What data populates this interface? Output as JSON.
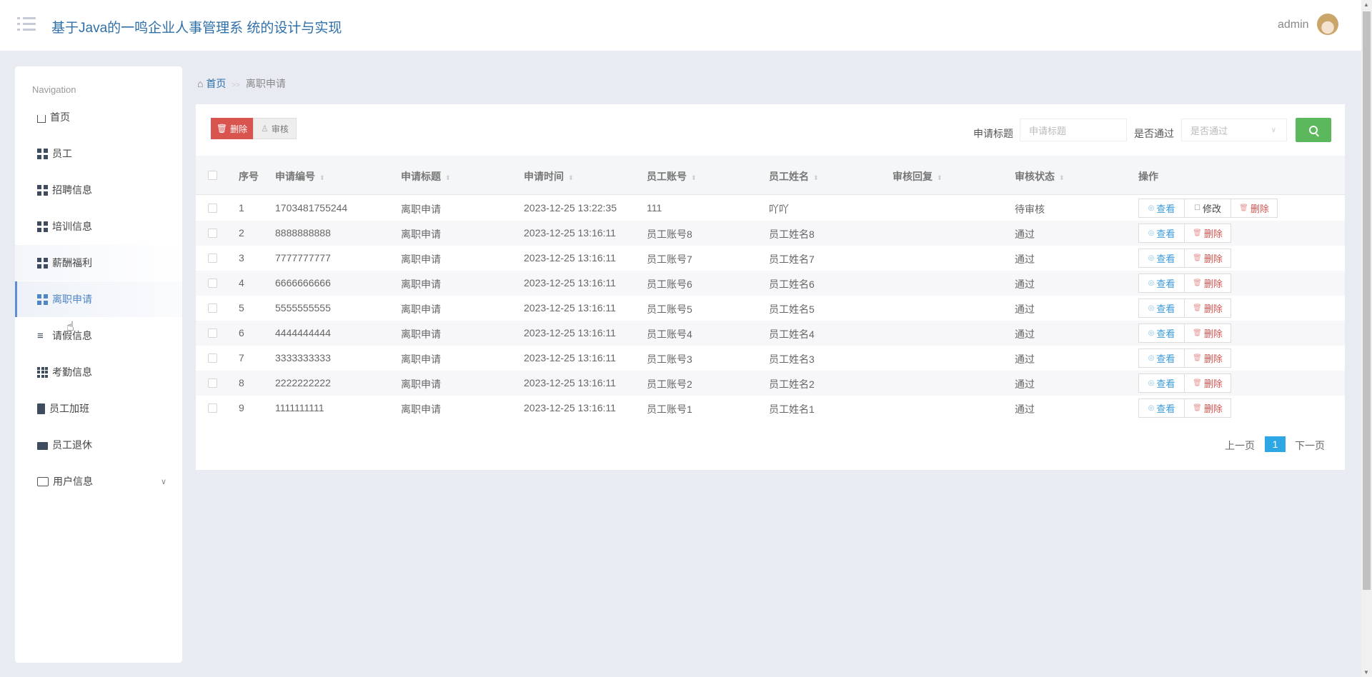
{
  "header": {
    "title": "基于Java的一鸣企业人事管理系 统的设计与实现",
    "user": "admin"
  },
  "sidebar": {
    "label": "Navigation",
    "items": [
      {
        "label": "首页",
        "icon": "home-icon"
      },
      {
        "label": "员工",
        "icon": "grid-icon"
      },
      {
        "label": "招聘信息",
        "icon": "grid-icon"
      },
      {
        "label": "培训信息",
        "icon": "grid-icon"
      },
      {
        "label": "薪酬福利",
        "icon": "grid-icon"
      },
      {
        "label": "离职申请",
        "icon": "grid-icon"
      },
      {
        "label": "请假信息",
        "icon": "sliders-icon"
      },
      {
        "label": "考勤信息",
        "icon": "grid-9-icon"
      },
      {
        "label": "员工加班",
        "icon": "clipboard-icon"
      },
      {
        "label": "员工退休",
        "icon": "briefcase-icon"
      },
      {
        "label": "用户信息",
        "icon": "credit-card-icon"
      }
    ]
  },
  "breadcrumb": {
    "home": "首页",
    "sep": ">>",
    "current": "离职申请"
  },
  "toolbar": {
    "delete": "删除",
    "audit": "审核",
    "title_label": "申请标题",
    "title_placeholder": "申请标题",
    "pass_label": "是否通过",
    "pass_placeholder": "是否通过"
  },
  "table": {
    "headers": [
      "序号",
      "申请编号",
      "申请标题",
      "申请时间",
      "员工账号",
      "员工姓名",
      "审核回复",
      "审核状态",
      "操作"
    ],
    "actions": {
      "view": "查看",
      "edit": "修改",
      "delete": "删除"
    },
    "rows": [
      {
        "no": "1",
        "code": "1703481755244",
        "title": "离职申请",
        "time": "2023-12-25 13:22:35",
        "account": "111",
        "name": "吖吖",
        "reply": "",
        "status": "待审核",
        "editable": true
      },
      {
        "no": "2",
        "code": "8888888888",
        "title": "离职申请",
        "time": "2023-12-25 13:16:11",
        "account": "员工账号8",
        "name": "员工姓名8",
        "reply": "",
        "status": "通过"
      },
      {
        "no": "3",
        "code": "7777777777",
        "title": "离职申请",
        "time": "2023-12-25 13:16:11",
        "account": "员工账号7",
        "name": "员工姓名7",
        "reply": "",
        "status": "通过"
      },
      {
        "no": "4",
        "code": "6666666666",
        "title": "离职申请",
        "time": "2023-12-25 13:16:11",
        "account": "员工账号6",
        "name": "员工姓名6",
        "reply": "",
        "status": "通过"
      },
      {
        "no": "5",
        "code": "5555555555",
        "title": "离职申请",
        "time": "2023-12-25 13:16:11",
        "account": "员工账号5",
        "name": "员工姓名5",
        "reply": "",
        "status": "通过"
      },
      {
        "no": "6",
        "code": "4444444444",
        "title": "离职申请",
        "time": "2023-12-25 13:16:11",
        "account": "员工账号4",
        "name": "员工姓名4",
        "reply": "",
        "status": "通过"
      },
      {
        "no": "7",
        "code": "3333333333",
        "title": "离职申请",
        "time": "2023-12-25 13:16:11",
        "account": "员工账号3",
        "name": "员工姓名3",
        "reply": "",
        "status": "通过"
      },
      {
        "no": "8",
        "code": "2222222222",
        "title": "离职申请",
        "time": "2023-12-25 13:16:11",
        "account": "员工账号2",
        "name": "员工姓名2",
        "reply": "",
        "status": "通过"
      },
      {
        "no": "9",
        "code": "1111111111",
        "title": "离职申请",
        "time": "2023-12-25 13:16:11",
        "account": "员工账号1",
        "name": "员工姓名1",
        "reply": "",
        "status": "通过"
      }
    ]
  },
  "pagination": {
    "prev": "上一页",
    "current": "1",
    "next": "下一页"
  }
}
